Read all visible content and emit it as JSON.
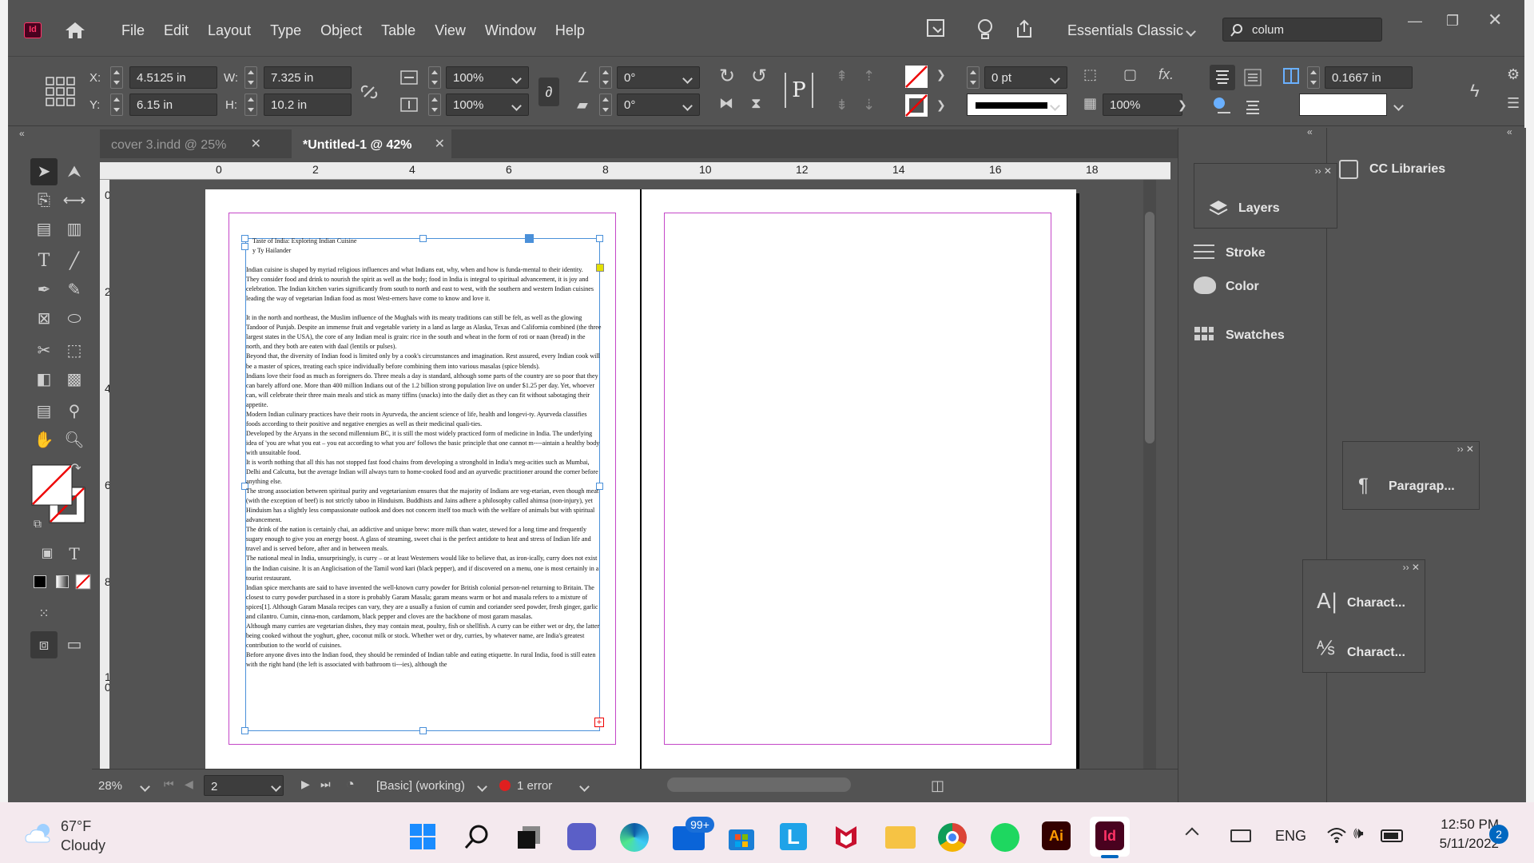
{
  "app": {
    "logo": "Id",
    "menu": [
      "File",
      "Edit",
      "Layout",
      "Type",
      "Object",
      "Table",
      "View",
      "Window",
      "Help"
    ],
    "workspace": "Essentials Classic",
    "search_value": "colum"
  },
  "control": {
    "x_label": "X:",
    "x_value": "4.5125 in",
    "y_label": "Y:",
    "y_value": "6.15 in",
    "w_label": "W:",
    "w_value": "7.325 in",
    "h_label": "H:",
    "h_value": "10.2 in",
    "scale_x": "100%",
    "scale_y": "100%",
    "rotate": "0°",
    "shear": "0°",
    "stroke_weight": "0 pt",
    "opacity": "100%",
    "column_gutter": "0.1667 in"
  },
  "tabs": [
    {
      "label": "cover 3.indd @ 25%",
      "active": false
    },
    {
      "label": "*Untitled-1 @ 42%",
      "active": true
    }
  ],
  "ruler": {
    "h_marks": [
      "0",
      "2",
      "4",
      "6",
      "8",
      "10",
      "12",
      "14",
      "16",
      "18"
    ],
    "v_marks": [
      "0",
      "2",
      "4",
      "6",
      "8",
      "1\n0"
    ]
  },
  "story": {
    "title": "Taste of India: Exploring Indian Cuisine",
    "byline": "y Ty Hailander",
    "paragraphs": [
      "Indian cuisine is shaped by myriad religious influences and what Indians eat, why, when and how is funda-mental to their identity.",
      "They consider food and drink to nourish the spirit as well as the body; food in India is integral to spiritual advancement, it is joy and celebration. The Indian kitchen varies significantly from south to north and east to west, with the southern and western Indian cuisines leading the way of vegetarian Indian food as most West-erners have come to know and love it.",
      "",
      "It in the north and northeast, the Muslim influence of the Mughals with its meaty traditions can still be felt, as well as the glowing Tandoor of Punjab. Despite an immense fruit and vegetable variety in a land as large as Alaska, Texas and California combined (the three largest states in the USA), the core of any Indian meal is grain: rice in the south and wheat in the form of roti or naan (bread) in the north, and they both are eaten with daal (lentils or pulses).",
      "Beyond that, the diversity of Indian food is limited only by a cook's circumstances and imagination. Rest assured, every Indian cook will be a master of spices, treating each spice individually before combining them into various masalas (spice blends).",
      "Indians love their food as much as foreigners do. Three meals a day is standard, although some parts of the country are so poor that they can barely afford one. More than 400 million Indians out of the 1.2 billion strong population live on under $1.25 per day. Yet, whoever can, will celebrate their three main meals and stick as many tiffins (snacks) into the daily diet as they can fit without sabotaging their appetite.",
      "Modern Indian culinary practices have their roots in Ayurveda, the ancient science of life, health and longevi-ty. Ayurveda classifies foods according to their positive and negative energies as well as their medicinal quali-ties.",
      "Developed by the Aryans in the second millennium BC, it is still the most widely practiced form of medicine in India. The underlying idea of 'you are what you eat – you eat according to what you are' follows the basic principle that one cannot m----aintain a healthy body with unsuitable food.",
      "It is worth nothing that all this has not stopped fast food chains from developing a stronghold in India's meg-acities such as Mumbai, Delhi and Calcutta, but the average Indian will always turn to home-cooked food and an ayurvedic practitioner around the corner before anything else.",
      "The strong association between spiritual purity and vegetarianism ensures that the majority of Indians are veg-etarian, even though meat (with the exception of beef) is not strictly taboo in Hinduism. Buddhists and Jains adhere a philosophy called ahimsa (non-injury), yet Hinduism has a slightly less compassionate outlook and does not concern itself too much with the welfare of animals but with spiritual advancement.",
      "The drink of the nation is certainly chai, an addictive and unique brew: more milk than water, stewed for a long time and frequently sugary enough to give you an energy boost. A glass of steaming, sweet chai is the perfect antidote to heat and stress of Indian life and travel and is served before, after and in between meals.",
      "The national meal in India, unsurprisingly, is curry – or at least Westerners would like to believe that, as iron-ically, curry does not exist in the Indian cuisine. It is an Anglicisation of the Tamil word kari (black pepper), and if discovered on a menu, one is most certainly in a tourist restaurant.",
      "Indian spice merchants are said to have invented the well-known curry powder for British colonial person-nel returning to Britain. The closest to curry powder purchased in a store is probably Garam Masala; garam means warm or hot and masala refers to a mixture of spices[1]. Although Garam Masala recipes can vary, they are a usually a fusion of cumin and coriander seed powder, fresh ginger, garlic and cilantro. Cumin, cinna-mon, cardamom, black pepper and cloves are the backbone of most garam masalas.",
      "Although many curries are vegetarian dishes, they may contain meat, poultry, fish or shellfish. A curry can be either wet or dry, the latter being cooked without the yoghurt, ghee, coconut milk or stock. Whether wet or dry, curries, by whatever name, are India's greatest contribution to the world of cuisines.",
      "Before anyone dives into the Indian food, they should be reminded of Indian table and eating etiquette. In rural India, food is still eaten with the right hand (the left is associated with bathroom ti---ies), although the"
    ]
  },
  "status": {
    "zoom": "28%",
    "page": "2",
    "style": "[Basic] (working)",
    "errors": "1 error"
  },
  "panels": {
    "cc_libraries": "CC Libraries",
    "layers": "Layers",
    "stroke": "Stroke",
    "color": "Color",
    "swatches": "Swatches",
    "paragraph": "Paragrap...",
    "character1": "Charact...",
    "character2": "Charact..."
  },
  "taskbar": {
    "temp": "67°F",
    "weather": "Cloudy",
    "mail_badge": "99+",
    "lang": "ENG",
    "time": "12:50 PM",
    "date": "5/11/2022",
    "notif_count": "2"
  }
}
